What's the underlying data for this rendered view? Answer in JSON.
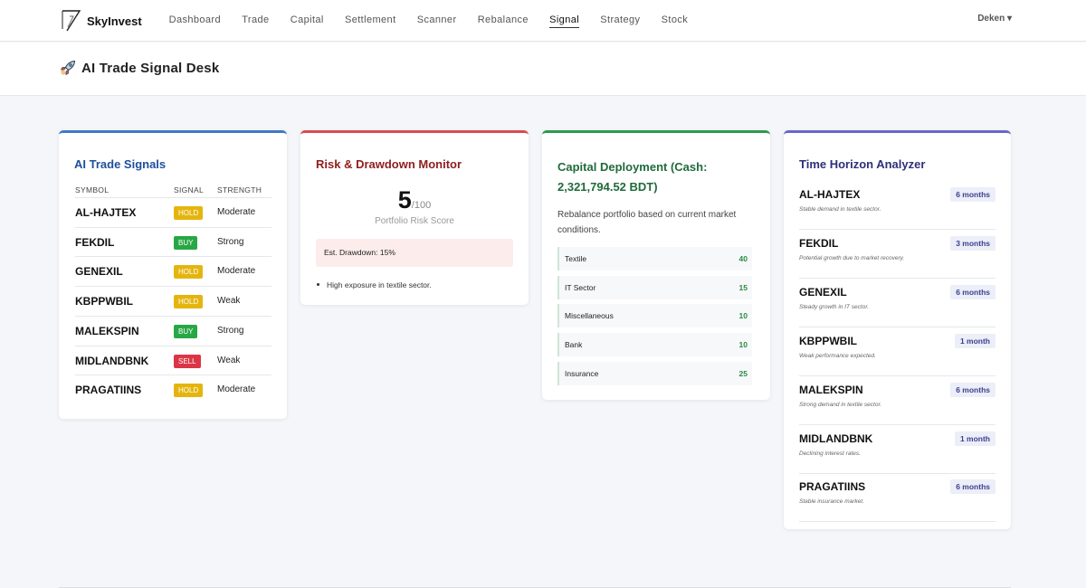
{
  "brand": {
    "name": "SkyInvest"
  },
  "nav": {
    "items": [
      "Dashboard",
      "Trade",
      "Capital",
      "Settlement",
      "Scanner",
      "Rebalance",
      "Signal",
      "Strategy",
      "Stock"
    ],
    "active": "Signal"
  },
  "user": {
    "label": "Deken ▾"
  },
  "page": {
    "title": "AI Trade Signal Desk",
    "icon": "rocket-icon"
  },
  "colors": {
    "buy": "#28a745",
    "hold": "#e5b50f",
    "sell": "#dc3545",
    "signals_accent": "#3f79c8",
    "risk_accent": "#d94c4c",
    "capital_accent": "#2d9a4e",
    "horizon_accent": "#6a67c9"
  },
  "signals": {
    "title": "AI Trade Signals",
    "headers": {
      "symbol": "SYMBOL",
      "signal": "SIGNAL",
      "strength": "STRENGTH"
    },
    "rows": [
      {
        "symbol": "AL-HAJTEX",
        "signal": "HOLD",
        "strength": "Moderate"
      },
      {
        "symbol": "FEKDIL",
        "signal": "BUY",
        "strength": "Strong"
      },
      {
        "symbol": "GENEXIL",
        "signal": "HOLD",
        "strength": "Moderate"
      },
      {
        "symbol": "KBPPWBIL",
        "signal": "HOLD",
        "strength": "Weak"
      },
      {
        "symbol": "MALEKSPIN",
        "signal": "BUY",
        "strength": "Strong"
      },
      {
        "symbol": "MIDLANDBNK",
        "signal": "SELL",
        "strength": "Weak"
      },
      {
        "symbol": "PRAGATIINS",
        "signal": "HOLD",
        "strength": "Moderate"
      }
    ]
  },
  "risk": {
    "title": "Risk & Drawdown Monitor",
    "score": "5",
    "score_max": "/100",
    "score_label": "Portfolio Risk Score",
    "drawdown": "Est. Drawdown: 15%",
    "notes": [
      "High exposure in textile sector."
    ]
  },
  "capital": {
    "title": "Capital Deployment (Cash: 2,321,794.52 BDT)",
    "description": "Rebalance portfolio based on current market conditions.",
    "sectors": [
      {
        "name": "Textile",
        "value": "40"
      },
      {
        "name": "IT Sector",
        "value": "15"
      },
      {
        "name": "Miscellaneous",
        "value": "10"
      },
      {
        "name": "Bank",
        "value": "10"
      },
      {
        "name": "Insurance",
        "value": "25"
      }
    ]
  },
  "horizon": {
    "title": "Time Horizon Analyzer",
    "rows": [
      {
        "symbol": "AL-HAJTEX",
        "horizon": "6 months",
        "note": "Stable demand in textile sector."
      },
      {
        "symbol": "FEKDIL",
        "horizon": "3 months",
        "note": "Potential growth due to market recovery."
      },
      {
        "symbol": "GENEXIL",
        "horizon": "6 months",
        "note": "Steady growth in IT sector."
      },
      {
        "symbol": "KBPPWBIL",
        "horizon": "1 month",
        "note": "Weak performance expected."
      },
      {
        "symbol": "MALEKSPIN",
        "horizon": "6 months",
        "note": "Strong demand in textile sector."
      },
      {
        "symbol": "MIDLANDBNK",
        "horizon": "1 month",
        "note": "Declining interest rates."
      },
      {
        "symbol": "PRAGATIINS",
        "horizon": "6 months",
        "note": "Stable insurance market."
      }
    ]
  }
}
